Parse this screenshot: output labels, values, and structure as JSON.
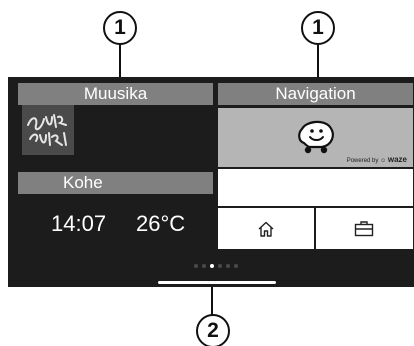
{
  "callouts": {
    "top_left": "1",
    "top_right": "1",
    "bottom": "2"
  },
  "music_widget": {
    "title": "Muusika",
    "album_art_text": "daft punk"
  },
  "now_widget": {
    "title": "Kohe",
    "time": "14:07",
    "temperature": "26°C"
  },
  "navigation_widget": {
    "title": "Navigation",
    "map_app_icon": "waze-icon",
    "powered_by": "Powered by",
    "brand": "waze",
    "buttons": [
      {
        "icon": "home-icon"
      },
      {
        "icon": "briefcase-icon"
      }
    ]
  },
  "pager": {
    "page_count": 6,
    "active_page": 3
  },
  "colors": {
    "screen_background": "#1c1c1c",
    "widget_title_bar": "#808080",
    "map_background": "#b5b5b5",
    "text": "#ffffff"
  }
}
